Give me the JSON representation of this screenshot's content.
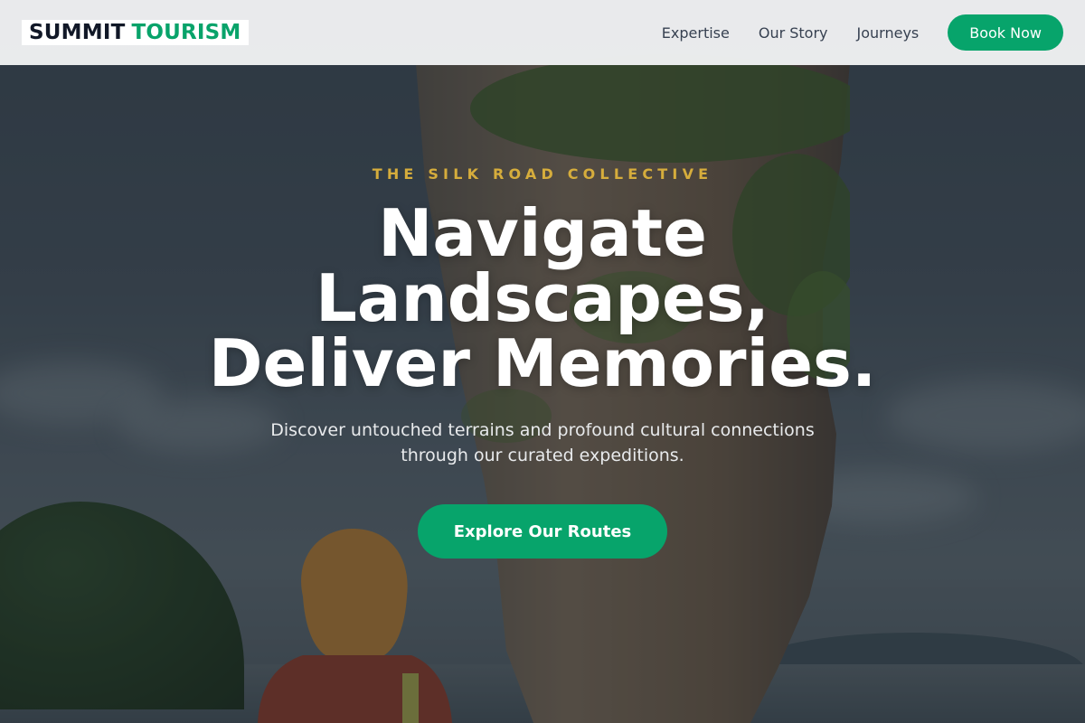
{
  "brand": {
    "word1": "SUMMIT",
    "word2": "TOURISM"
  },
  "nav": {
    "links": [
      "Expertise",
      "Our Story",
      "Journeys"
    ],
    "cta_label": "Book Now"
  },
  "hero": {
    "eyebrow": "THE SILK ROAD COLLECTIVE",
    "headline": [
      "Navigate",
      "Landscapes,",
      "Deliver Memories."
    ],
    "subtext": "Discover untouched terrains and profound cultural connections through our curated expeditions.",
    "cta_label": "Explore Our Routes"
  },
  "colors": {
    "accent": "#07a46b",
    "eyebrow": "#d6ad3c",
    "logo_dark": "#111827"
  }
}
